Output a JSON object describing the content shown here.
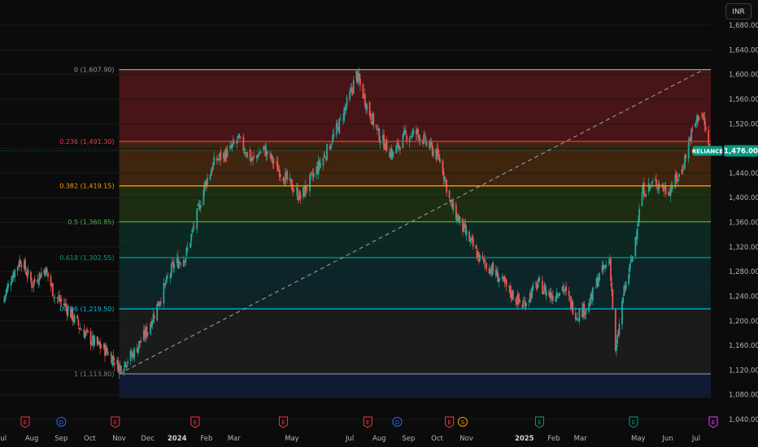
{
  "currency_label": "INR",
  "chart_data": {
    "type": "candlestick",
    "symbol": "RELIANCE",
    "last_price_label": "1,476.00",
    "last_price": 1476,
    "ylim": [
      1030,
      1700
    ],
    "y_ticks": [
      "1,040.00",
      "1,080.00",
      "1,120.00",
      "1,160.00",
      "1,200.00",
      "1,240.00",
      "1,280.00",
      "1,320.00",
      "1,360.00",
      "1,400.00",
      "1,440.00",
      "1,480.00",
      "1,520.00",
      "1,560.00",
      "1,600.00",
      "1,640.00",
      "1,680.00"
    ],
    "y_tick_values": [
      1040,
      1080,
      1120,
      1160,
      1200,
      1240,
      1280,
      1320,
      1360,
      1400,
      1440,
      1480,
      1520,
      1560,
      1600,
      1640,
      1680
    ],
    "x_ticks": [
      "Jul",
      "Aug",
      "Sep",
      "Oct",
      "Nov",
      "Dec",
      "2024",
      "Feb",
      "Mar",
      "May",
      "Jul",
      "Aug",
      "Sep",
      "Oct",
      "Nov",
      "2025",
      "Feb",
      "Mar",
      "May",
      "Jun",
      "Jul"
    ],
    "x_tick_bold": [
      "2024",
      "2025"
    ],
    "x_range": [
      "2023-07",
      "2025-07"
    ],
    "fib_levels": [
      {
        "ratio": "0",
        "value": 1607.9,
        "label": "0 (1,607.90)",
        "color": "#9598a1",
        "fill": "#7a1f23"
      },
      {
        "ratio": "0.236",
        "value": 1491.3,
        "label": "0.236 (1,491.30)",
        "color": "#f23645",
        "fill": "#6b3a12"
      },
      {
        "ratio": "0.382",
        "value": 1419.15,
        "label": "0.382 (1,419.15)",
        "color": "#ff9800",
        "fill": "#2d4a17"
      },
      {
        "ratio": "0.5",
        "value": 1360.85,
        "label": "0.5 (1,360.85)",
        "color": "#4caf50",
        "fill": "#0d4436"
      },
      {
        "ratio": "0.618",
        "value": 1302.55,
        "label": "0.618 (1,302.55)",
        "color": "#089981",
        "fill": "#0d3d44"
      },
      {
        "ratio": "0.786",
        "value": 1219.5,
        "label": "0.786 (1,219.50)",
        "color": "#00bcd4",
        "fill": "#2a2a2a"
      },
      {
        "ratio": "1",
        "value": 1113.8,
        "label": "1 (1,113.80)",
        "color": "#787b86",
        "fill": "#172859"
      }
    ],
    "trendline": {
      "from": {
        "date": "2023-11-01",
        "value": 1113.8
      },
      "to": {
        "date": "2025-07-09",
        "value": 1607.9
      }
    },
    "events": [
      {
        "label": "E",
        "color": "#f23645"
      },
      {
        "label": "D",
        "color": "#2962ff"
      },
      {
        "label": "E",
        "color": "#f23645"
      },
      {
        "label": "E",
        "color": "#f23645"
      },
      {
        "label": "E",
        "color": "#f23645"
      },
      {
        "label": "E",
        "color": "#f23645"
      },
      {
        "label": "D",
        "color": "#2962ff"
      },
      {
        "label": "E",
        "color": "#f23645"
      },
      {
        "label": "S",
        "color": "#ff9800"
      },
      {
        "label": "E",
        "color": "#089981"
      },
      {
        "label": "E",
        "color": "#089981"
      },
      {
        "label": "E",
        "color": "#e040fb"
      }
    ],
    "series": [
      {
        "name": "RELIANCE",
        "close_path": [
          [
            "2023-07-01",
            1230
          ],
          [
            "2023-07-10",
            1270
          ],
          [
            "2023-07-20",
            1300
          ],
          [
            "2023-08-01",
            1260
          ],
          [
            "2023-08-15",
            1285
          ],
          [
            "2023-08-25",
            1240
          ],
          [
            "2023-09-05",
            1225
          ],
          [
            "2023-09-20",
            1190
          ],
          [
            "2023-10-05",
            1165
          ],
          [
            "2023-10-20",
            1150
          ],
          [
            "2023-11-01",
            1125
          ],
          [
            "2023-11-15",
            1145
          ],
          [
            "2023-12-01",
            1185
          ],
          [
            "2023-12-15",
            1240
          ],
          [
            "2023-12-28",
            1290
          ],
          [
            "2024-01-10",
            1305
          ],
          [
            "2024-01-20",
            1360
          ],
          [
            "2024-01-30",
            1420
          ],
          [
            "2024-02-10",
            1460
          ],
          [
            "2024-02-25",
            1475
          ],
          [
            "2024-03-05",
            1495
          ],
          [
            "2024-03-20",
            1460
          ],
          [
            "2024-04-01",
            1480
          ],
          [
            "2024-04-15",
            1450
          ],
          [
            "2024-04-30",
            1420
          ],
          [
            "2024-05-10",
            1400
          ],
          [
            "2024-05-25",
            1440
          ],
          [
            "2024-06-05",
            1470
          ],
          [
            "2024-06-20",
            1520
          ],
          [
            "2024-07-01",
            1565
          ],
          [
            "2024-07-08",
            1600
          ],
          [
            "2024-07-20",
            1545
          ],
          [
            "2024-08-01",
            1500
          ],
          [
            "2024-08-15",
            1470
          ],
          [
            "2024-08-28",
            1500
          ],
          [
            "2024-09-10",
            1505
          ],
          [
            "2024-09-25",
            1480
          ],
          [
            "2024-10-05",
            1460
          ],
          [
            "2024-10-15",
            1390
          ],
          [
            "2024-10-30",
            1345
          ],
          [
            "2024-11-15",
            1300
          ],
          [
            "2024-11-30",
            1280
          ],
          [
            "2024-12-15",
            1250
          ],
          [
            "2024-12-30",
            1225
          ],
          [
            "2025-01-15",
            1260
          ],
          [
            "2025-01-30",
            1240
          ],
          [
            "2025-02-10",
            1255
          ],
          [
            "2025-02-25",
            1210
          ],
          [
            "2025-03-10",
            1225
          ],
          [
            "2025-03-20",
            1270
          ],
          [
            "2025-04-01",
            1300
          ],
          [
            "2025-04-07",
            1145
          ],
          [
            "2025-04-15",
            1240
          ],
          [
            "2025-04-25",
            1305
          ],
          [
            "2025-05-05",
            1410
          ],
          [
            "2025-05-20",
            1425
          ],
          [
            "2025-06-01",
            1410
          ],
          [
            "2025-06-15",
            1440
          ],
          [
            "2025-06-25",
            1500
          ],
          [
            "2025-07-05",
            1540
          ],
          [
            "2025-07-09",
            1525
          ],
          [
            "2025-07-15",
            1476
          ]
        ]
      }
    ]
  }
}
